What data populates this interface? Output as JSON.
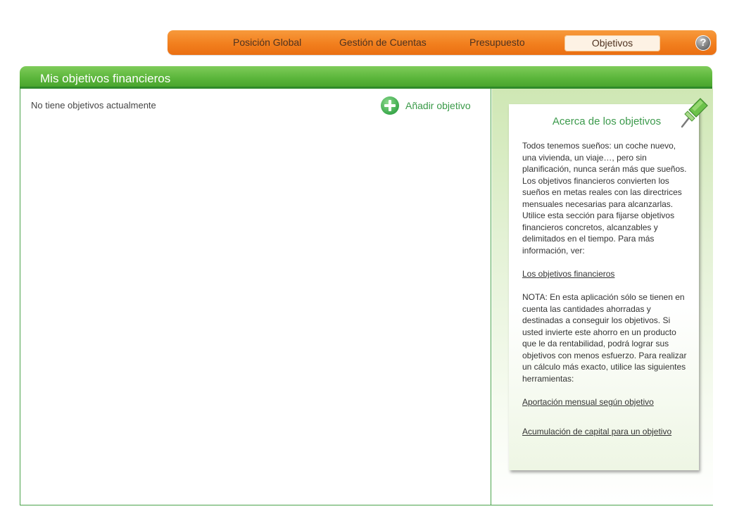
{
  "nav": {
    "items": [
      "Posición Global",
      "Gestión de Cuentas",
      "Presupuesto"
    ],
    "active": "Objetivos",
    "help_icon": "?"
  },
  "section": {
    "title": "Mis objetivos financieros"
  },
  "main": {
    "empty_message": "No tiene objetivos actualmente",
    "add_label": "Añadir objetivo",
    "add_icon": "plus-circle-icon"
  },
  "info": {
    "title": "Acerca de los objetivos",
    "pin_icon": "pushpin-icon",
    "intro": "Todos tenemos sueños: un coche nuevo, una vivienda, un viaje…, pero sin planificación, nunca serán más que sueños.  Los objetivos financieros convierten los sueños en metas reales con las directrices mensuales necesarias para alcanzarlas.  Utilice esta sección para fijarse objetivos financieros concretos, alcanzables y delimitados en el tiempo. Para más información, ver:",
    "link_1": "Los objetivos financieros",
    "note": "NOTA:  En esta aplicación sólo se tienen en cuenta las cantidades ahorradas y destinadas a conseguir los objetivos.  Si usted invierte este ahorro en un producto que le da rentabilidad, podrá lograr sus objetivos con menos esfuerzo. Para realizar un cálculo más exacto, utilice las siguientes herramientas:",
    "link_2": "Aportación mensual según objetivo",
    "link_3": "Acumulación de capital para un objetivo"
  },
  "colors": {
    "nav_orange": "#f27f1e",
    "header_green": "#5ab53a",
    "accent_green": "#3a9a48"
  }
}
